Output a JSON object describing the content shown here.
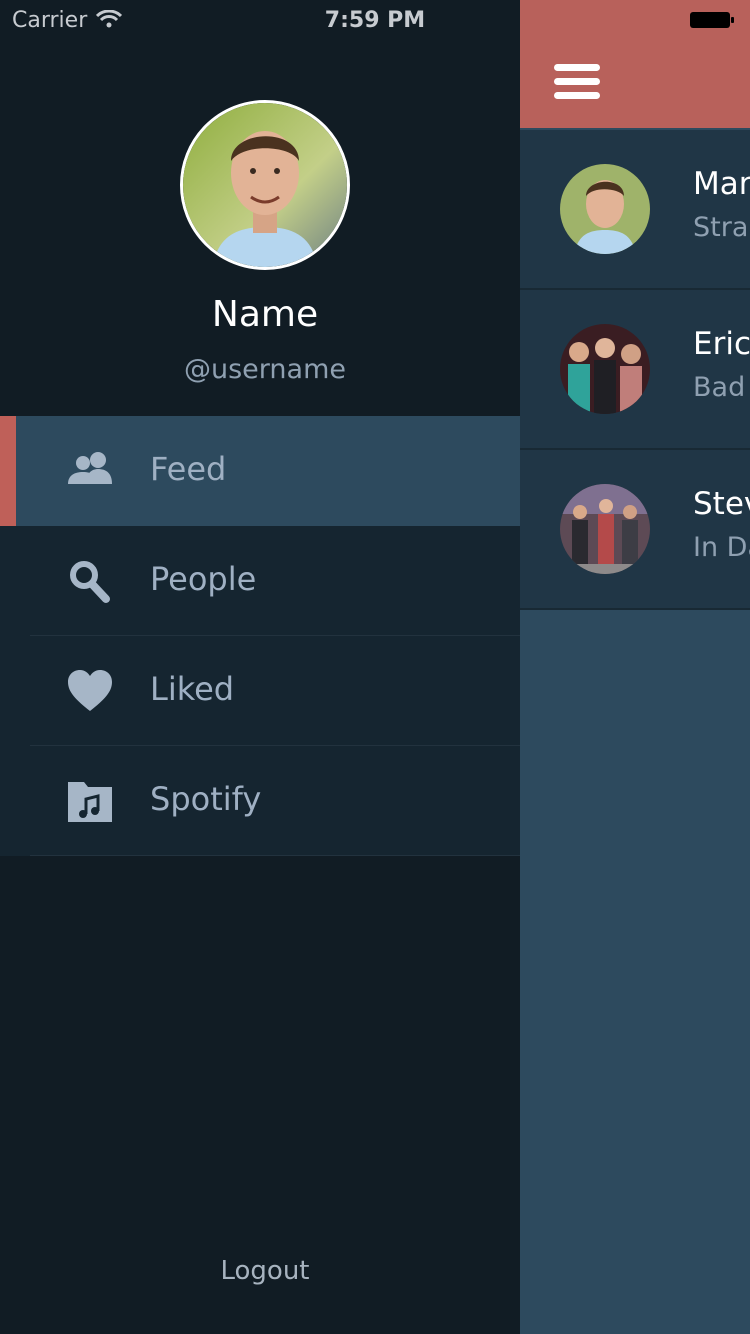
{
  "status_bar": {
    "carrier": "Carrier",
    "time": "7:59 PM"
  },
  "profile": {
    "name": "Name",
    "username": "@username"
  },
  "menu": {
    "items": [
      {
        "label": "Feed",
        "icon": "people-icon",
        "active": true
      },
      {
        "label": "People",
        "icon": "search-icon",
        "active": false
      },
      {
        "label": "Liked",
        "icon": "heart-icon",
        "active": false
      },
      {
        "label": "Spotify",
        "icon": "music-folder-icon",
        "active": false
      }
    ]
  },
  "logout_label": "Logout",
  "nav": {
    "menu_icon": "hamburger-menu-icon"
  },
  "feed": [
    {
      "name": "Mar",
      "subtitle": "Stran"
    },
    {
      "name": "Eric",
      "subtitle": "Bad"
    },
    {
      "name": "Stev",
      "subtitle": "In Da"
    }
  ],
  "colors": {
    "drawer_bg": "#111c24",
    "menu_bg": "#152530",
    "menu_active_bg": "#2d4a5e",
    "accent": "#bf6059",
    "nav_bar": "#b8615b",
    "main_bg": "#2d4a5e"
  }
}
